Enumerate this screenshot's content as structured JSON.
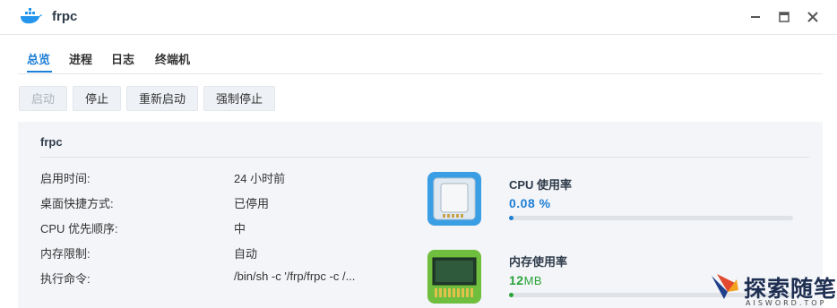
{
  "window": {
    "title": "frpc",
    "icon": "docker-whale-icon"
  },
  "tabs": [
    {
      "label": "总览",
      "active": true
    },
    {
      "label": "进程",
      "active": false
    },
    {
      "label": "日志",
      "active": false
    },
    {
      "label": "终端机",
      "active": false
    }
  ],
  "toolbar": {
    "start_label": "启动",
    "stop_label": "停止",
    "restart_label": "重新启动",
    "force_stop_label": "强制停止"
  },
  "panel": {
    "title": "frpc",
    "rows": [
      {
        "label": "启用时间:",
        "value": "24 小时前"
      },
      {
        "label": "桌面快捷方式:",
        "value": "已停用"
      },
      {
        "label": "CPU 优先顺序:",
        "value": "中"
      },
      {
        "label": "内存限制:",
        "value": "自动"
      },
      {
        "label": "执行命令:",
        "value": "/bin/sh -c '/frp/frpc -c /..."
      }
    ]
  },
  "resources": {
    "cpu": {
      "label": "CPU 使用率",
      "value": "0.08 %",
      "usage_fraction": 0.0008,
      "icon": "cpu-chip-icon"
    },
    "memory": {
      "label": "内存使用率",
      "value": "12",
      "unit": "MB",
      "usage_fraction": 0.01,
      "icon": "memory-module-icon"
    }
  },
  "watermark": {
    "text": "探索随笔",
    "sub": "AISWORD.TOP"
  },
  "colors": {
    "accent": "#1d7fd6",
    "memory": "#2aa33a",
    "panel_bg": "#f3f5f8"
  }
}
